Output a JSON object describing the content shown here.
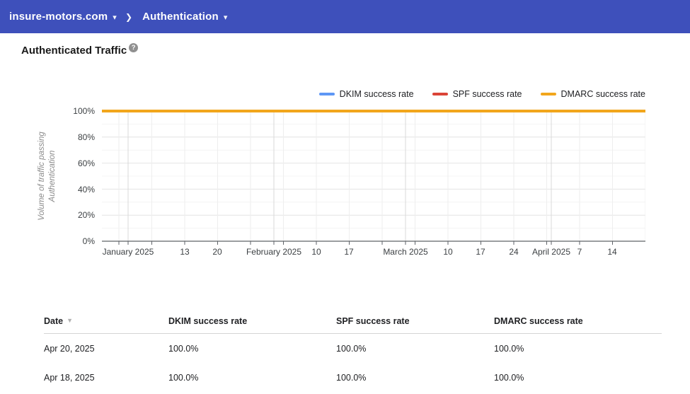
{
  "topbar": {
    "background": "#3E50BB",
    "domain_label": "insure-motors.com",
    "section_label": "Authentication",
    "caret_icon": "▾",
    "chevron_icon": "❯"
  },
  "page": {
    "title": "Authenticated Traffic",
    "help_glyph": "?"
  },
  "chart_data": {
    "type": "line",
    "title": "Authenticated Traffic",
    "ylabel": "Volume of traffic passing Authentication",
    "ylim": [
      0,
      100
    ],
    "y_unit": "%",
    "grid": true,
    "legend_position": "top-right",
    "x_range": [
      "January 2025",
      "April 2025"
    ],
    "y_tick_labels": [
      "100%",
      "80%",
      "60%",
      "40%",
      "20%",
      "0%"
    ],
    "x_tick_labels": [
      "January 2025",
      "13",
      "20",
      "February 2025",
      "10",
      "17",
      "March 2025",
      "10",
      "17",
      "24",
      "April 2025",
      "7",
      "14"
    ],
    "series": [
      {
        "name": "DKIM success rate",
        "color": "#5E97F5",
        "constant_value_pct": 100.0
      },
      {
        "name": "SPF success rate",
        "color": "#DB4437",
        "constant_value_pct": 100.0
      },
      {
        "name": "DMARC success rate",
        "color": "#F2A61C",
        "constant_value_pct": 100.0
      }
    ],
    "note": "All three series are flat at 100% for the entire date range; the DMARC (orange) line is drawn on top and hides the DKIM and SPF lines."
  },
  "table": {
    "columns": [
      "Date",
      "DKIM success rate",
      "SPF success rate",
      "DMARC success rate"
    ],
    "sort_column": "Date",
    "sort_direction": "desc",
    "sort_icon": "▼",
    "rows": [
      [
        "Apr 20, 2025",
        "100.0%",
        "100.0%",
        "100.0%"
      ],
      [
        "Apr 18, 2025",
        "100.0%",
        "100.0%",
        "100.0%"
      ]
    ]
  }
}
